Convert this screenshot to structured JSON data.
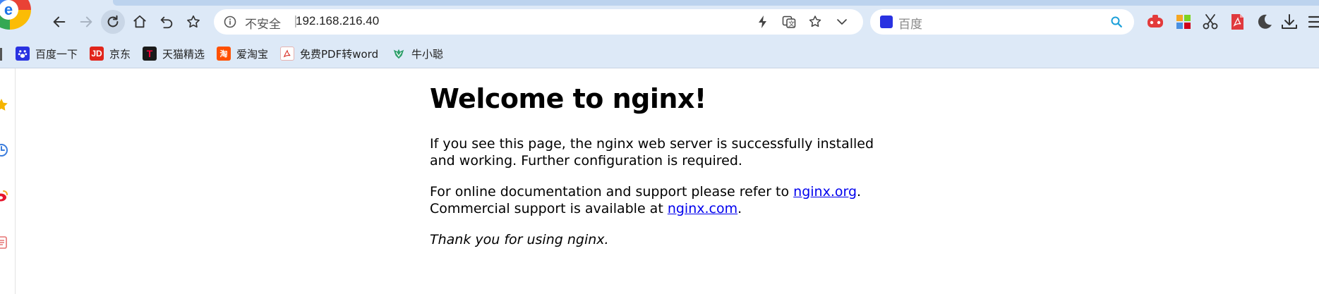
{
  "toolbar": {
    "back": "back-arrow-icon",
    "forward": "forward-arrow-icon",
    "reload": "reload-icon",
    "home": "home-icon",
    "undo": "undo-icon",
    "favorite": "star-icon"
  },
  "address": {
    "security_label": "不安全",
    "separator": "|",
    "url": "192.168.216.40"
  },
  "search": {
    "placeholder": "百度"
  },
  "bookmarks": [
    {
      "label": "百度一下",
      "icon": "baidu-paw-icon",
      "color": "#2932e1"
    },
    {
      "label": "京东",
      "icon": "jd-icon",
      "color": "#e1251b"
    },
    {
      "label": "天猫精选",
      "icon": "tmall-icon",
      "color": "#1a1a1a"
    },
    {
      "label": "爱淘宝",
      "icon": "taobao-icon",
      "color": "#ff5000"
    },
    {
      "label": "免费PDF转word",
      "icon": "pdf-icon",
      "color": "#d9342b"
    },
    {
      "label": "牛小聪",
      "icon": "leaf-icon",
      "color": "#2e9f6b"
    }
  ],
  "page": {
    "title": "Welcome to nginx!",
    "p1": "If you see this page, the nginx web server is successfully installed and working. Further configuration is required.",
    "p2_prefix": "For online documentation and support please refer to ",
    "link1": "nginx.org",
    "p2_mid": ".",
    "p2_line2_prefix": "Commercial support is available at ",
    "link2": "nginx.com",
    "p2_suffix": ".",
    "thanks": "Thank you for using nginx."
  },
  "colors": {
    "chrome_bg": "#dde9f7",
    "link": "#0000ee",
    "search_accent": "#1a9fd9"
  }
}
